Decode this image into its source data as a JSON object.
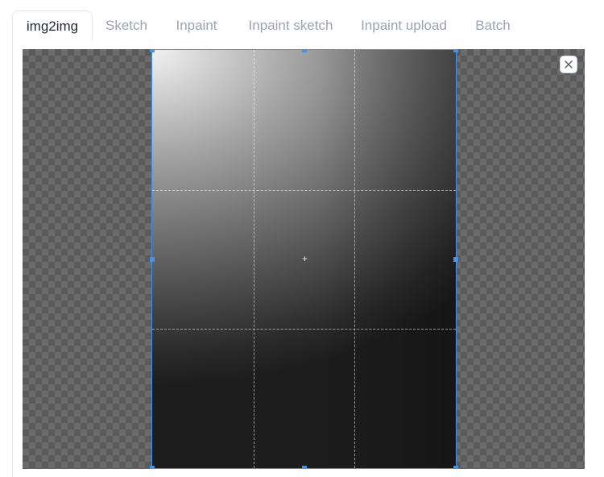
{
  "tabs": [
    {
      "label": "img2img",
      "active": true
    },
    {
      "label": "Sketch",
      "active": false
    },
    {
      "label": "Inpaint",
      "active": false
    },
    {
      "label": "Inpaint sketch",
      "active": false
    },
    {
      "label": "Inpaint upload",
      "active": false
    },
    {
      "label": "Batch",
      "active": false
    }
  ],
  "canvas": {
    "background_pattern": "checkerboard",
    "image_description_icon": "gradient-image",
    "crop_handles": true
  },
  "controls": {
    "close_icon": "close-icon",
    "center_icon": "crosshair-icon"
  },
  "colors": {
    "accent": "#4a90e2",
    "tab_active_text": "#1f2937",
    "tab_inactive_text": "#9ca3af",
    "border": "#e5e7eb"
  },
  "center_glyph": "+"
}
